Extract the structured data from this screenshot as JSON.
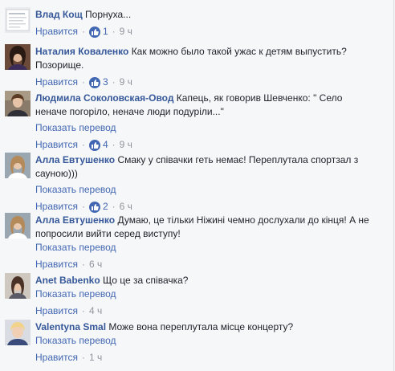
{
  "labels": {
    "like": "Нравится",
    "translate": "Показать перевод",
    "separator": "·"
  },
  "colors": {
    "author": "#365899",
    "link": "#4267b2",
    "meta": "#90949c",
    "background": "#f6f7f9"
  },
  "comments": [
    {
      "author": "Влад Кощ",
      "lines": [
        "Порнуха..."
      ],
      "likes": "1",
      "time": "9 ч",
      "avatar": "document-thumbnail"
    },
    {
      "author": "Наталия Коваленко",
      "lines": [
        "Как можно было такой ужас к детям выпустить?",
        "Позорище."
      ],
      "likes": "3",
      "time": "9 ч",
      "avatar": "woman-portrait"
    },
    {
      "author": "Людмила Соколовская-Овод",
      "lines": [
        "Капець, як говорив Шевченко: \" Село",
        "неначе погоріло, неначе люди подуріли...\""
      ],
      "translate": true,
      "likes": "4",
      "time": "9 ч",
      "avatar": "woman-portrait"
    },
    {
      "author": "Алла Евтушенко",
      "lines": [
        "Смаку у співачки геть немає! Переплутала спортзал з",
        "сауною)))"
      ],
      "translate": true,
      "likes": "2",
      "time": "6 ч",
      "avatar": "woman-portrait"
    },
    {
      "author": "Алла Евтушенко",
      "lines": [
        "Думаю, це тільки Ніжині чемно дослухали до кінця! А не",
        "попросили вийти серед виступу!"
      ],
      "translate": true,
      "time": "6 ч",
      "avatar": "woman-portrait"
    },
    {
      "author": "Anet Babenko",
      "lines": [
        "Що це за співачка?"
      ],
      "translate": true,
      "time": "4 ч",
      "avatar": "woman-portrait"
    },
    {
      "author": "Valentyna Smal",
      "lines": [
        "Може вона переплутала місце концерту?"
      ],
      "translate": true,
      "time": "1 ч",
      "avatar": "woman-portrait"
    }
  ]
}
